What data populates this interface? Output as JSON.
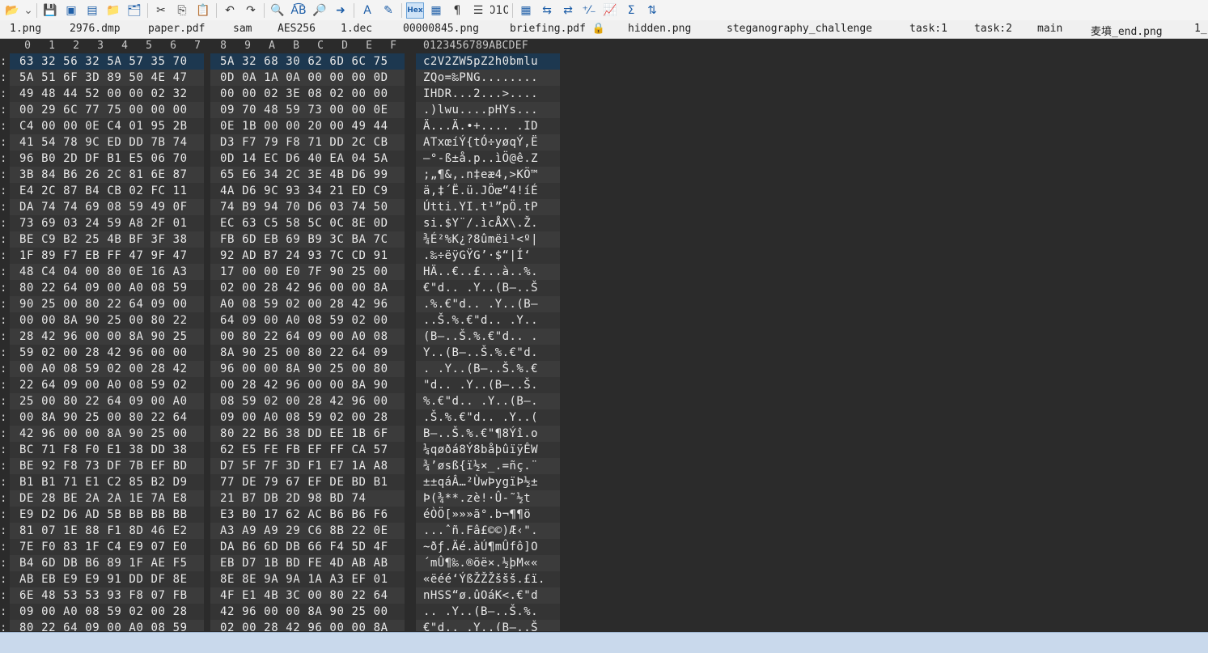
{
  "toolbar": {
    "buttons": [
      {
        "name": "open-folder-icon",
        "glyph": "📂"
      },
      {
        "name": "dropdown-arrow-icon",
        "glyph": "⌄"
      },
      {
        "name": "save-icon",
        "glyph": "💾"
      },
      {
        "name": "save-all-icon",
        "glyph": "▣"
      },
      {
        "name": "save-copy-icon",
        "glyph": "▤"
      },
      {
        "name": "folder-icon",
        "glyph": "📁"
      },
      {
        "name": "folders-icon",
        "glyph": "🗂"
      },
      {
        "name": "cut-icon",
        "glyph": "✂"
      },
      {
        "name": "copy-icon",
        "glyph": "⎘"
      },
      {
        "name": "paste-icon",
        "glyph": "📋"
      },
      {
        "name": "undo-icon",
        "glyph": "↶"
      },
      {
        "name": "redo-icon",
        "glyph": "↷"
      },
      {
        "name": "find-icon",
        "glyph": "🔍"
      },
      {
        "name": "replace-icon",
        "glyph": "A͡B"
      },
      {
        "name": "find-in-files-icon",
        "glyph": "🔎"
      },
      {
        "name": "goto-icon",
        "glyph": "➜"
      },
      {
        "name": "font-icon",
        "glyph": "A"
      },
      {
        "name": "highlight-icon",
        "glyph": "✎"
      },
      {
        "name": "hex-mode-icon",
        "glyph": "Hex",
        "active": true
      },
      {
        "name": "column-mode-icon",
        "glyph": "▦"
      },
      {
        "name": "pilcrow-icon",
        "glyph": "¶"
      },
      {
        "name": "word-wrap-icon",
        "glyph": "☰"
      },
      {
        "name": "binary-icon",
        "glyph": "010"
      },
      {
        "name": "calculator-icon",
        "glyph": "▦"
      },
      {
        "name": "compare-icon",
        "glyph": "⇆"
      },
      {
        "name": "swap-icon",
        "glyph": "⇄"
      },
      {
        "name": "percent-icon",
        "glyph": "⁺⁄₋"
      },
      {
        "name": "chart-icon",
        "glyph": "📈"
      },
      {
        "name": "checksum-icon",
        "glyph": "Σ"
      },
      {
        "name": "base-convert-icon",
        "glyph": "⇅"
      }
    ]
  },
  "tabs": [
    "1.png",
    "2976.dmp",
    "paper.pdf",
    "sam",
    "AES256",
    "1.dec",
    "00000845.png",
    "briefing.pdf 🔒",
    "hidden.png",
    "steganography_challenge",
    "task:1",
    "task:2",
    "main",
    "麦墳_end.png",
    "1_"
  ],
  "columns": {
    "hex": [
      "0",
      "1",
      "2",
      "3",
      "4",
      "5",
      "6",
      "7",
      "8",
      "9",
      "A",
      "B",
      "C",
      "D",
      "E",
      "F"
    ],
    "ascii_header": "0123456789ABCDEF"
  },
  "rows": [
    {
      "g0": "63 32 56 32 5A 57 35 70",
      "g1": "5A 32 68 30 62 6D 6C 75",
      "ascii": "c2V2ZW5pZ2h0bmlu"
    },
    {
      "g0": "5A 51 6F 3D 89 50 4E 47",
      "g1": "0D 0A 1A 0A 00 00 00 0D",
      "ascii": "ZQo=‰PNG........"
    },
    {
      "g0": "49 48 44 52 00 00 02 32",
      "g1": "00 00 02 3E 08 02 00 00",
      "ascii": "IHDR...2...>...."
    },
    {
      "g0": "00 29 6C 77 75 00 00 00",
      "g1": "09 70 48 59 73 00 00 0E",
      "ascii": ".)lwu....pHYs..."
    },
    {
      "g0": "C4 00 00 0E C4 01 95 2B",
      "g1": "0E 1B 00 00 20 00 49 44",
      "ascii": "Ä...Ä.•+.... .ID"
    },
    {
      "g0": "41 54 78 9C ED DD 7B 74",
      "g1": "D3 F7 79 F8 71 DD 2C CB",
      "ascii": "ATxœíÝ{tÓ÷yøqÝ,Ë"
    },
    {
      "g0": "96 B0 2D DF B1 E5 06 70",
      "g1": "0D 14 EC D6 40 EA 04 5A",
      "ascii": "–°-ß±å.p..ìÖ@ê.Z"
    },
    {
      "g0": "3B 84 B6 26 2C 81 6E 87",
      "g1": "65 E6 34 2C 3E 4B D6 99",
      "ascii": ";„¶&,.n‡eæ4,>KÖ™"
    },
    {
      "g0": "E4 2C 87 B4 CB 02 FC 11",
      "g1": "4A D6 9C 93 34 21 ED C9",
      "ascii": "ä,‡´Ë.ü.JÖœ“4!íÉ"
    },
    {
      "g0": "DA 74 74 69 08 59 49 0F",
      "g1": "74 B9 94 70 D6 03 74 50",
      "ascii": "Útti.YI.t¹”pÖ.tP"
    },
    {
      "g0": "73 69 03 24 59 A8 2F 01",
      "g1": "EC 63 C5 58 5C 0C 8E 0D",
      "ascii": "si.$Y¨/.ìcÅX\\.Ž."
    },
    {
      "g0": "BE C9 B2 25 4B BF 3F 38",
      "g1": "FB 6D EB 69 B9 3C BA 7C",
      "ascii": "¾É²%K¿?8ûmëi¹<º|"
    },
    {
      "g0": "1F 89 F7 EB FF 47 9F 47",
      "g1": "92 AD B7 24 93 7C CD 91",
      "ascii": ".‰÷ëÿGŸG’­·$“|Í‘"
    },
    {
      "g0": "48 C4 04 00 80 0E 16 A3",
      "g1": "17 00 00 E0 7F 90 25 00",
      "ascii": "HÄ..€..£...à..%."
    },
    {
      "g0": "80 22 64 09 00 A0 08 59",
      "g1": "02 00 28 42 96 00 00 8A",
      "ascii": "€\"d.. .Y..(B–..Š"
    },
    {
      "g0": "90 25 00 80 22 64 09 00",
      "g1": "A0 08 59 02 00 28 42 96",
      "ascii": ".%.€\"d.. .Y..(B–"
    },
    {
      "g0": "00 00 8A 90 25 00 80 22",
      "g1": "64 09 00 A0 08 59 02 00",
      "ascii": "..Š.%.€\"d.. .Y.."
    },
    {
      "g0": "28 42 96 00 00 8A 90 25",
      "g1": "00 80 22 64 09 00 A0 08",
      "ascii": "(B–..Š.%.€\"d.. ."
    },
    {
      "g0": "59 02 00 28 42 96 00 00",
      "g1": "8A 90 25 00 80 22 64 09",
      "ascii": "Y..(B–..Š.%.€\"d."
    },
    {
      "g0": "00 A0 08 59 02 00 28 42",
      "g1": "96 00 00 8A 90 25 00 80",
      "ascii": ". .Y..(B–..Š.%.€"
    },
    {
      "g0": "22 64 09 00 A0 08 59 02",
      "g1": "00 28 42 96 00 00 8A 90",
      "ascii": "\"d.. .Y..(B–..Š."
    },
    {
      "g0": "25 00 80 22 64 09 00 A0",
      "g1": "08 59 02 00 28 42 96 00",
      "ascii": "%.€\"d.. .Y..(B–."
    },
    {
      "g0": "00 8A 90 25 00 80 22 64",
      "g1": "09 00 A0 08 59 02 00 28",
      "ascii": ".Š.%.€\"d.. .Y..("
    },
    {
      "g0": "42 96 00 00 8A 90 25 00",
      "g1": "80 22 B6 38 DD EE 1B 6F",
      "ascii": "B–..Š.%.€\"¶8Ýî.o"
    },
    {
      "g0": "BC 71 F8 F0 E1 38 DD 38",
      "g1": "62 E5 FE FB EF FF CA 57",
      "ascii": "¼qøðá8Ý8båþûïÿÊW"
    },
    {
      "g0": "BE 92 F8 73 DF 7B EF BD",
      "g1": "D7 5F 7F 3D F1 E7 1A A8",
      "ascii": "¾’øsß{ï½×_.=ñç.¨"
    },
    {
      "g0": "B1 B1 71 E1 C2 85 B2 D9",
      "g1": "77 DE 79 67 EF DE BD B1",
      "ascii": "±±qáÂ…²ÙwÞygïÞ½±"
    },
    {
      "g0": "DE 28 BE 2A 2A 1E 7A E8",
      "g1": "21 B7 DB 2D 98 BD 74",
      "ascii": "Þ(¾**.zè!·Û-˜½t"
    },
    {
      "g0": "E9 D2 D6 AD 5B BB BB BB",
      "g1": "E3 B0 17 62 AC B6 B6 F6",
      "ascii": "éÒÖ­[»»»ã°.b¬¶¶ö"
    },
    {
      "g0": "81 07 1E 88 F1 8D 46 E2",
      "g1": "A3 A9 A9 29 C6 8B 22 0E",
      "ascii": "...ˆñ.Fâ£©©)Æ‹\"."
    },
    {
      "g0": "7E F0 83 1F C4 E9 07 E0",
      "g1": "DA B6 6D DB 66 F4 5D 4F",
      "ascii": "~ðƒ.Äé.àÚ¶mÛfô]O"
    },
    {
      "g0": "B4 6D DB B6 89 1F AE F5",
      "g1": "EB D7 1B BD FE 4D AB AB",
      "ascii": "´mÛ¶‰.®õë×.½þM««"
    },
    {
      "g0": "AB EB E9 E9 91 DD DF 8E",
      "g1": "8E 8E 9A 9A 1A A3 EF 01",
      "ascii": "«ëéé‘ÝßŽŽŽššš.£ï."
    },
    {
      "g0": "6E 48 53 53 93 F8 07 FB",
      "g1": "4F E1 4B 3C 00 80 22 64",
      "ascii": "nHSS“ø.ûOáK<.€\"d"
    },
    {
      "g0": "09 00 A0 08 59 02 00 28",
      "g1": "42 96 00 00 8A 90 25 00",
      "ascii": ".. .Y..(B–..Š.%."
    },
    {
      "g0": "80 22 64 09 00 A0 08 59",
      "g1": "02 00 28 42 96 00 00 8A",
      "ascii": "€\"d.. .Y..(B–..Š"
    }
  ]
}
